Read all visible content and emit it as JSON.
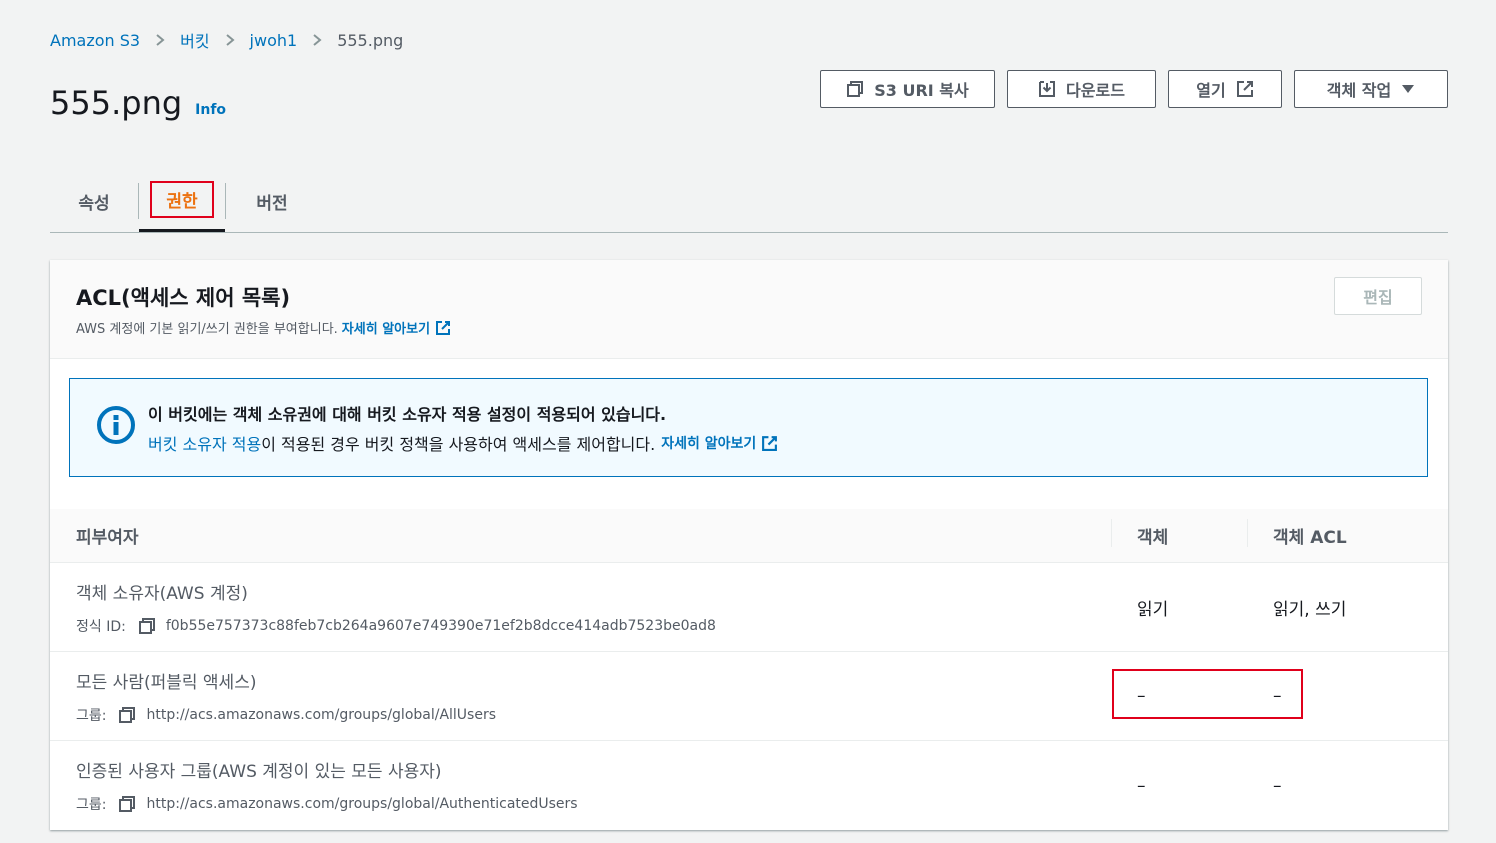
{
  "breadcrumb": {
    "items": [
      "Amazon S3",
      "버킷",
      "jwoh1"
    ],
    "current": "555.png"
  },
  "header": {
    "title": "555.png",
    "info": "Info"
  },
  "actions": {
    "copy_uri": "S3 URI 복사",
    "download": "다운로드",
    "open": "열기",
    "object_actions": "객체 작업"
  },
  "tabs": {
    "properties": "속성",
    "permissions": "권한",
    "versions": "버전"
  },
  "acl": {
    "title": "ACL(액세스 제어 목록)",
    "description": "AWS 계정에 기본 읽기/쓰기 권한을 부여합니다.",
    "learn_more": "자세히 알아보기",
    "edit": "편집"
  },
  "alert": {
    "title": "이 버킷에는 객체 소유권에 대해 버킷 소유자 적용 설정이 적용되어 있습니다.",
    "link1": "버킷 소유자 적용",
    "body": "이 적용된 경우 버킷 정책을 사용하여 액세스를 제어합니다.",
    "learn_more": "자세히 알아보기"
  },
  "table": {
    "headers": {
      "grantee": "피부여자",
      "object": "객체",
      "object_acl": "객체 ACL"
    },
    "rows": [
      {
        "grantee": "객체 소유자(AWS 계정)",
        "sub_label": "정식 ID:",
        "sub_value": "f0b55e757373c88feb7cb264a9607e749390e71ef2b8dcce414adb7523be0ad8",
        "object": "읽기",
        "object_acl": "읽기, 쓰기"
      },
      {
        "grantee": "모든 사람(퍼블릭 액세스)",
        "sub_label": "그룹:",
        "sub_value": "http://acs.amazonaws.com/groups/global/AllUsers",
        "object": "–",
        "object_acl": "–"
      },
      {
        "grantee": "인증된 사용자 그룹(AWS 계정이 있는 모든 사용자)",
        "sub_label": "그룹:",
        "sub_value": "http://acs.amazonaws.com/groups/global/AuthenticatedUsers",
        "object": "–",
        "object_acl": "–"
      }
    ]
  },
  "icons": {
    "chevron": "chevron-right-icon",
    "copy": "copy-icon",
    "download": "download-icon",
    "external": "external-link-icon",
    "caret": "caret-down-icon",
    "info": "info-circle-icon"
  },
  "colors": {
    "link": "#0073bb",
    "active_tab": "#ec7211",
    "highlight_box": "#e0001b"
  }
}
